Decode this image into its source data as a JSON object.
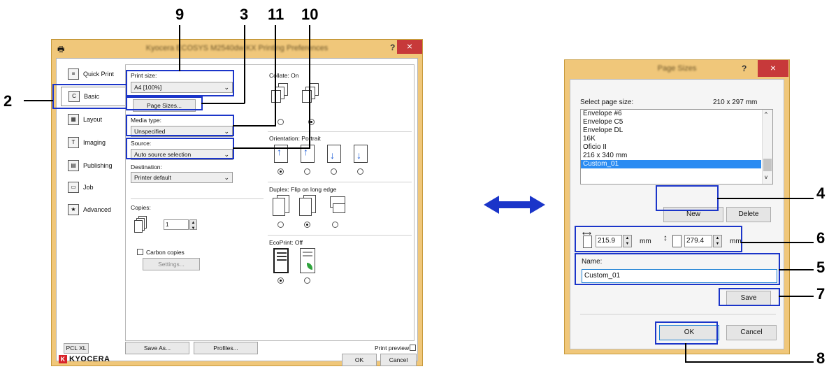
{
  "callouts": {
    "n9": "9",
    "n3": "3",
    "n11": "11",
    "n10": "10",
    "n2": "2",
    "n4": "4",
    "n6": "6",
    "n5": "5",
    "n7": "7",
    "n8": "8"
  },
  "printing_prefs": {
    "title": "Kyocera ECOSYS M2540dw KX Printing Preferences",
    "help": "?",
    "close": "×",
    "tabs": [
      "Quick Print",
      "Basic",
      "Layout",
      "Imaging",
      "Publishing",
      "Job",
      "Advanced"
    ],
    "print_size_label": "Print size:",
    "print_size_value": "A4 [100%]",
    "page_sizes_button": "Page Sizes...",
    "media_type_label": "Media type:",
    "media_type_value": "Unspecified",
    "source_label": "Source:",
    "source_value": "Auto source selection",
    "destination_label": "Destination:",
    "destination_value": "Printer default",
    "copies_label": "Copies:",
    "copies_value": "1",
    "carbon_copies_label": "Carbon copies",
    "settings_button": "Settings...",
    "collate_label": "Collate:  On",
    "orientation_label": "Orientation:  Portrait",
    "duplex_label": "Duplex:  Flip on long edge",
    "ecoprint_label": "EcoPrint:  Off",
    "pcl_button": "PCL XL",
    "save_as_button": "Save As...",
    "profiles_button": "Profiles...",
    "print_preview_label": "Print preview",
    "ok_button": "OK",
    "cancel_button": "Cancel",
    "logo_text": "KYOCERA"
  },
  "page_sizes_dialog": {
    "title": "Page Sizes",
    "help": "?",
    "close": "×",
    "select_label": "Select page size:",
    "size_readout": "210 x 297 mm",
    "list_items": [
      "Envelope #6",
      "Envelope C5",
      "Envelope DL",
      "16K",
      "Oficio II",
      "216 x 340 mm",
      "Custom_01"
    ],
    "selected_index": 6,
    "new_button": "New",
    "delete_button": "Delete",
    "width_value": "215.9",
    "height_value": "279.4",
    "unit_mm": "mm",
    "unit_mm_cut": "mm",
    "name_label": "Name:",
    "name_value": "Custom_01",
    "save_button": "Save",
    "ok_button": "OK",
    "cancel_button": "Cancel"
  },
  "colors": {
    "callout_box": "#1b35c9",
    "window_frame": "#f0c77a",
    "close_button": "#c7393a",
    "selection": "#2a8bf2",
    "double_arrow": "#1b35c9"
  }
}
